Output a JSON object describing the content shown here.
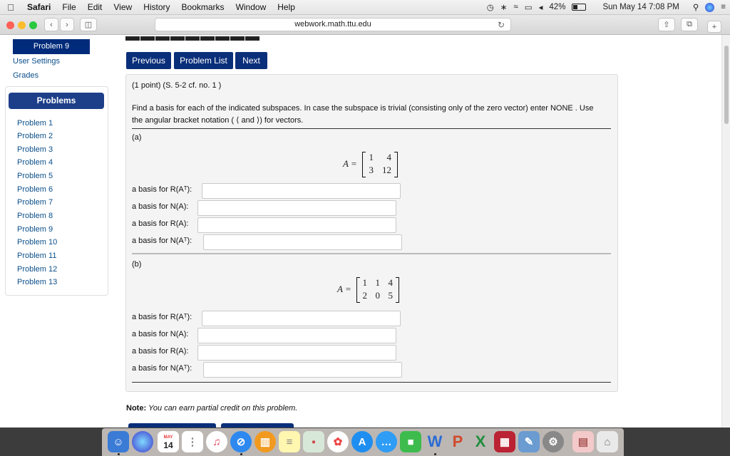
{
  "menubar": {
    "app": "Safari",
    "menus": [
      "File",
      "Edit",
      "View",
      "History",
      "Bookmarks",
      "Window",
      "Help"
    ],
    "battery": "42%",
    "clock": "Sun May 14  7:08 PM"
  },
  "browser": {
    "url": "webwork.math.ttu.edu"
  },
  "sidebar": {
    "current": "Problem 9",
    "links": [
      "User Settings",
      "Grades"
    ],
    "problems_header": "Problems",
    "problems": [
      "Problem 1",
      "Problem 2",
      "Problem 3",
      "Problem 4",
      "Problem 5",
      "Problem 6",
      "Problem 7",
      "Problem 8",
      "Problem 9",
      "Problem 10",
      "Problem 11",
      "Problem 12",
      "Problem 13"
    ]
  },
  "nav": {
    "previous": "Previous",
    "list": "Problem List",
    "next": "Next"
  },
  "problem": {
    "meta": "(1 point) (S. 5-2 cf. no. 1 )",
    "instruction_1": "Find a basis for each of the indicated subspaces. In case the subspace is trivial (consisting only of the zero vector) enter NONE  . Use",
    "instruction_2": "the angular bracket notation ( ⟨ and ⟩) for vectors.",
    "part_a": {
      "label": "(a)",
      "matrix_label": "A =",
      "matrix": [
        [
          "1",
          "4"
        ],
        [
          "3",
          "12"
        ]
      ],
      "prompts": [
        "a basis for R(Aᵀ):",
        "a basis for N(A):",
        "a basis for R(A):",
        "a basis for N(Aᵀ):"
      ]
    },
    "part_b": {
      "label": "(b)",
      "matrix_label": "A =",
      "matrix": [
        [
          "1",
          "1",
          "4"
        ],
        [
          "2",
          "0",
          "5"
        ]
      ],
      "prompts": [
        "a basis for R(Aᵀ):",
        "a basis for N(A):",
        "a basis for R(A):",
        "a basis for N(Aᵀ):"
      ]
    }
  },
  "note_label": "Note:",
  "note_text": "You can earn partial credit on this problem.",
  "dock": {
    "calendar_month": "MAY",
    "calendar_day": "14"
  }
}
